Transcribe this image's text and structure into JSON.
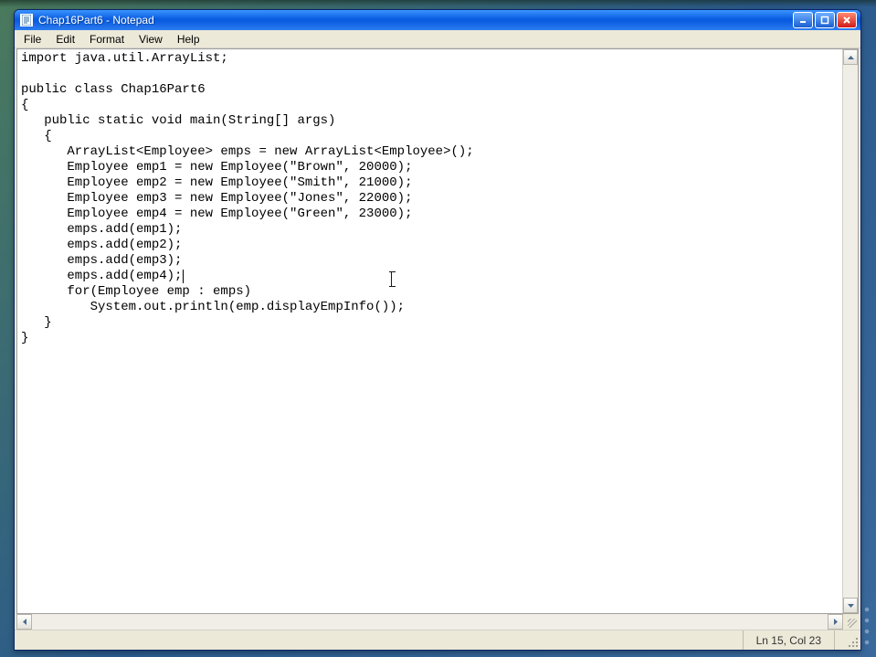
{
  "window": {
    "title": "Chap16Part6 - Notepad"
  },
  "menubar": {
    "items": [
      "File",
      "Edit",
      "Format",
      "View",
      "Help"
    ]
  },
  "editor": {
    "content": "import java.util.ArrayList;\n\npublic class Chap16Part6\n{\n   public static void main(String[] args)\n   {\n      ArrayList<Employee> emps = new ArrayList<Employee>();\n      Employee emp1 = new Employee(\"Brown\", 20000);\n      Employee emp2 = new Employee(\"Smith\", 21000);\n      Employee emp3 = new Employee(\"Jones\", 22000);\n      Employee emp4 = new Employee(\"Green\", 23000);\n      emps.add(emp1);\n      emps.add(emp2);\n      emps.add(emp3);\n      emps.add(emp4);\n      for(Employee emp : emps)\n         System.out.println(emp.displayEmpInfo());\n   }\n}",
    "caret_line": 15,
    "caret_col": 23
  },
  "statusbar": {
    "position": "Ln 15, Col 23"
  }
}
